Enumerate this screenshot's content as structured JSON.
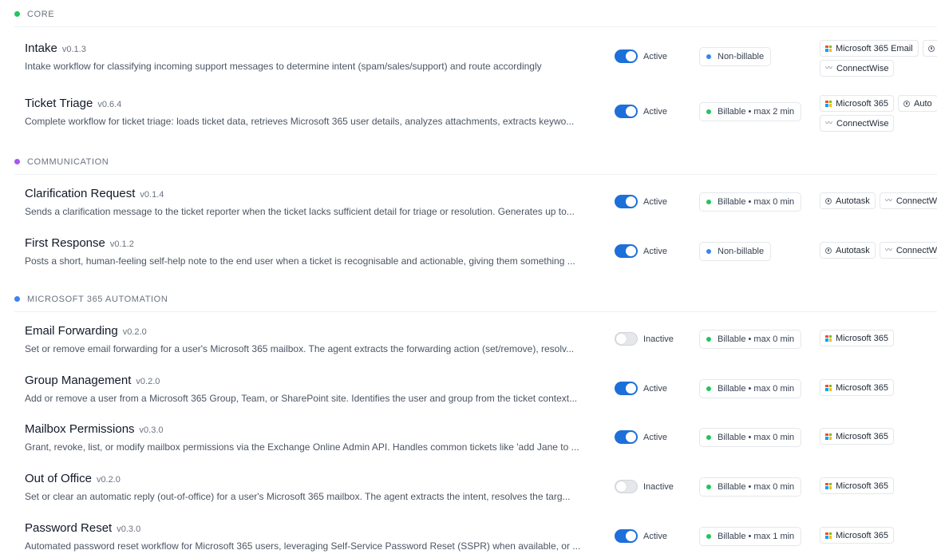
{
  "colors": {
    "core": "#22c55e",
    "communication": "#a855f7",
    "m365": "#3b82f6",
    "billable_dot": "#22c55e",
    "nonbillable_dot": "#3b82f6",
    "toggle_on": "#1d6fd9"
  },
  "sections": {
    "core": {
      "label": "CORE",
      "rows": [
        {
          "title": "Intake",
          "version": "v0.1.3",
          "description": "Intake workflow for classifying incoming support messages to determine intent (spam/sales/support) and route accordingly",
          "status": "Active",
          "billing": "Non-billable",
          "integrations": [
            "Microsoft 365 Email",
            "ConnectWise"
          ]
        },
        {
          "title": "Ticket Triage",
          "version": "v0.6.4",
          "description": "Complete workflow for ticket triage: loads ticket data, retrieves Microsoft 365 user details, analyzes attachments, extracts keywo...",
          "status": "Active",
          "billing": "Billable • max 2 min",
          "integrations": [
            "Microsoft 365",
            "Auto",
            "ConnectWise"
          ]
        }
      ]
    },
    "communication": {
      "label": "COMMUNICATION",
      "rows": [
        {
          "title": "Clarification Request",
          "version": "v0.1.4",
          "description": "Sends a clarification message to the ticket reporter when the ticket lacks sufficient detail for triage or resolution. Generates up to...",
          "status": "Active",
          "billing": "Billable • max 0 min",
          "integrations": [
            "Autotask",
            "ConnectW"
          ]
        },
        {
          "title": "First Response",
          "version": "v0.1.2",
          "description": "Posts a short, human-feeling self-help note to the end user when a ticket is recognisable and actionable, giving them something ...",
          "status": "Active",
          "billing": "Non-billable",
          "integrations": [
            "Autotask",
            "ConnectW"
          ]
        }
      ]
    },
    "m365": {
      "label": "MICROSOFT 365 AUTOMATION",
      "rows": [
        {
          "title": "Email Forwarding",
          "version": "v0.2.0",
          "description": "Set or remove email forwarding for a user's Microsoft 365 mailbox. The agent extracts the forwarding action (set/remove), resolv...",
          "status": "Inactive",
          "billing": "Billable • max 0 min",
          "integrations": [
            "Microsoft 365"
          ]
        },
        {
          "title": "Group Management",
          "version": "v0.2.0",
          "description": "Add or remove a user from a Microsoft 365 Group, Team, or SharePoint site. Identifies the user and group from the ticket context...",
          "status": "Active",
          "billing": "Billable • max 0 min",
          "integrations": [
            "Microsoft 365"
          ]
        },
        {
          "title": "Mailbox Permissions",
          "version": "v0.3.0",
          "description": "Grant, revoke, list, or modify mailbox permissions via the Exchange Online Admin API. Handles common tickets like 'add Jane to ...",
          "status": "Active",
          "billing": "Billable • max 0 min",
          "integrations": [
            "Microsoft 365"
          ]
        },
        {
          "title": "Out of Office",
          "version": "v0.2.0",
          "description": "Set or clear an automatic reply (out-of-office) for a user's Microsoft 365 mailbox. The agent extracts the intent, resolves the targ...",
          "status": "Inactive",
          "billing": "Billable • max 0 min",
          "integrations": [
            "Microsoft 365"
          ]
        },
        {
          "title": "Password Reset",
          "version": "v0.3.0",
          "description": "Automated password reset workflow for Microsoft 365 users, leveraging Self-Service Password Reset (SSPR) when available, or ...",
          "status": "Active",
          "billing": "Billable • max 1 min",
          "integrations": [
            "Microsoft 365"
          ]
        }
      ]
    }
  }
}
